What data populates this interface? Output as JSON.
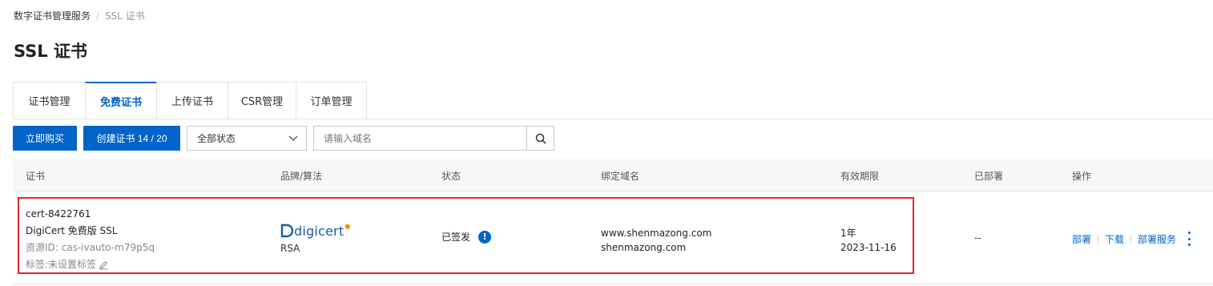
{
  "breadcrumb": {
    "parent": "数字证书管理服务",
    "separator": "/",
    "current": "SSL 证书"
  },
  "page_title": "SSL 证书",
  "tabs": [
    {
      "label": "证书管理",
      "active": false
    },
    {
      "label": "免费证书",
      "active": true
    },
    {
      "label": "上传证书",
      "active": false
    },
    {
      "label": "CSR管理",
      "active": false
    },
    {
      "label": "订单管理",
      "active": false
    }
  ],
  "toolbar": {
    "buy_label": "立即购买",
    "create_label": "创建证书 14 / 20",
    "status_select": "全部状态",
    "search_placeholder": "请输入域名"
  },
  "table": {
    "headers": {
      "cert": "证书",
      "brand": "品牌/算法",
      "status": "状态",
      "domain": "绑定域名",
      "validity": "有效期限",
      "deployed": "已部署",
      "ops": "操作"
    },
    "rows": [
      {
        "cert_name": "cert-8422761",
        "cert_type": "DigiCert 免费版 SSL",
        "resource_id": "资源ID: cas-ivauto-m79p5q",
        "tag": "标签:未设置标签",
        "brand_logo": "digicert",
        "algorithm": "RSA",
        "status": "已签发",
        "status_icon": "!",
        "domains": [
          "www.shenmazong.com",
          "shenmazong.com"
        ],
        "validity_period": "1年",
        "expiry_date": "2023-11-16",
        "deployed": "--",
        "actions": [
          "部署",
          "下载",
          "部署服务"
        ]
      }
    ]
  },
  "colors": {
    "primary": "#0064c8",
    "highlight_border": "#e0282e"
  }
}
